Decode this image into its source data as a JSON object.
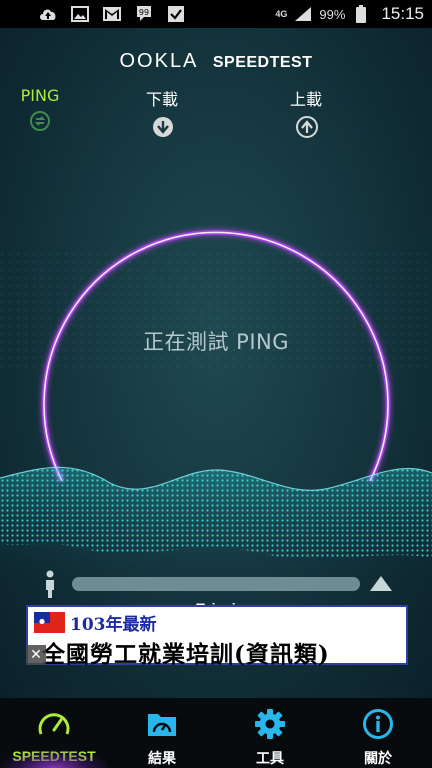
{
  "status_bar": {
    "icons": [
      "cloud-upload-icon",
      "image-icon",
      "gmail-icon",
      "chat-icon",
      "checkbox-icon"
    ],
    "network": "4G",
    "battery_percent": "99%",
    "time": "15:15"
  },
  "header": {
    "logo_brand": "OOKLA",
    "logo_product": "SPEEDTEST"
  },
  "metrics": {
    "ping_label": "PING",
    "download_label": "下載",
    "upload_label": "上載"
  },
  "gauge": {
    "status_text": "正在測試 PING"
  },
  "server": {
    "name": "Taipei",
    "progress": 0
  },
  "ad": {
    "line1": "103年最新",
    "line2": "全國勞工就業培訓(資訊類)",
    "close_label": "✕"
  },
  "nav": {
    "items": [
      {
        "label": "SPEEDTEST",
        "icon": "speedometer-icon",
        "active": true
      },
      {
        "label": "結果",
        "icon": "results-folder-icon",
        "active": false
      },
      {
        "label": "工具",
        "icon": "gear-icon",
        "active": false
      },
      {
        "label": "關於",
        "icon": "info-icon",
        "active": false
      }
    ]
  },
  "colors": {
    "accent_green": "#b0ec3a",
    "gauge_purple": "#a040e0",
    "wave_cyan": "#2fd8dc",
    "nav_blue": "#29b6ea"
  }
}
